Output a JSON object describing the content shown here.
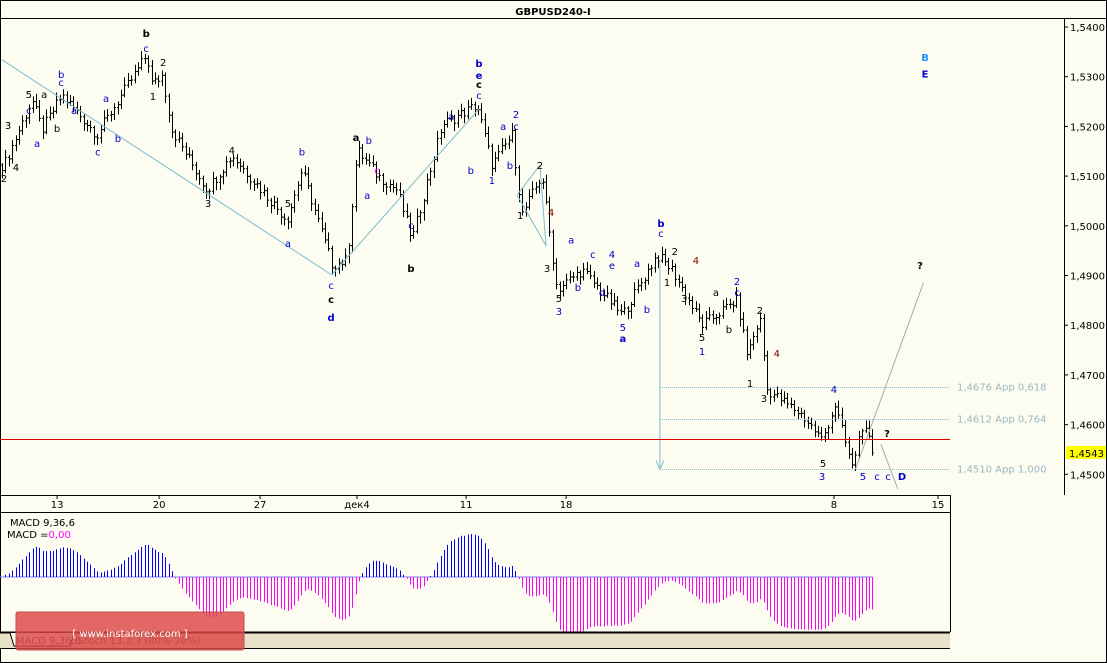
{
  "chart_data": {
    "type": "ohlc",
    "title": "GBPUSD240-I",
    "symbol": "GBPUSD",
    "timeframe": "H4",
    "ylim": [
      1.447,
      1.541
    ],
    "y_ticks": [
      "1,5400",
      "1,5300",
      "1,5200",
      "1,5100",
      "1,5000",
      "1,4900",
      "1,4800",
      "1,4700",
      "1,4600",
      "1,4500"
    ],
    "y_tick_values": [
      1.54,
      1.53,
      1.52,
      1.51,
      1.5,
      1.49,
      1.48,
      1.47,
      1.46,
      1.45
    ],
    "current_price": 1.4543,
    "current_price_label": "1,4543",
    "red_level": 1.4571,
    "x_ticks": [
      {
        "label": "13",
        "bar": 16.2
      },
      {
        "label": "20",
        "bar": 46.2
      },
      {
        "label": "27",
        "bar": 75.9
      },
      {
        "label": "дек4",
        "bar": 104.4
      },
      {
        "label": "11",
        "bar": 136.5
      },
      {
        "label": "18",
        "bar": 165.9
      },
      {
        "label": "8",
        "bar": 244.7
      },
      {
        "label": "15",
        "bar": 275.3
      }
    ],
    "price_path_pivots": [
      [
        0.6,
        1.5122
      ],
      [
        8.8,
        1.5253
      ],
      [
        11.8,
        1.5193
      ],
      [
        17.6,
        1.5263
      ],
      [
        27.9,
        1.5183
      ],
      [
        32.4,
        1.5233
      ],
      [
        42.6,
        1.5344
      ],
      [
        44.1,
        1.5283
      ],
      [
        47.1,
        1.5303
      ],
      [
        50,
        1.5193
      ],
      [
        60.3,
        1.5072
      ],
      [
        67.6,
        1.5142
      ],
      [
        83.8,
        1.5012
      ],
      [
        88.2,
        1.5112
      ],
      [
        97.1,
        1.4921
      ],
      [
        101.5,
        1.4931
      ],
      [
        104.4,
        1.5153
      ],
      [
        110.3,
        1.5102
      ],
      [
        116.2,
        1.5072
      ],
      [
        120.6,
        1.4972
      ],
      [
        129.4,
        1.5203
      ],
      [
        139.7,
        1.5243
      ],
      [
        144.1,
        1.5122
      ],
      [
        150,
        1.5183
      ],
      [
        152.9,
        1.5022
      ],
      [
        158.8,
        1.5102
      ],
      [
        163.2,
        1.4871
      ],
      [
        170.6,
        1.4911
      ],
      [
        182.4,
        1.482
      ],
      [
        192.6,
        1.4941
      ],
      [
        197.1,
        1.4911
      ],
      [
        205.9,
        1.48
      ],
      [
        216.2,
        1.4851
      ],
      [
        219.1,
        1.474
      ],
      [
        222.9,
        1.4815
      ],
      [
        225,
        1.467
      ],
      [
        235.3,
        1.4619
      ],
      [
        241.2,
        1.4569
      ],
      [
        245,
        1.4639
      ],
      [
        250,
        1.4513
      ],
      [
        252.9,
        1.4599
      ],
      [
        256.5,
        1.4543
      ]
    ],
    "fibo_levels": [
      {
        "price": 1.4676,
        "label": "1,4676 App 0,618"
      },
      {
        "price": 1.4612,
        "label": "1,4612 App 0,764"
      },
      {
        "price": 1.451,
        "label": "1,4510 App 1,000"
      }
    ],
    "fibo_start_bar": 193.5,
    "trend_lines": [
      {
        "from": [
          0,
          1.5334
        ],
        "to": [
          97,
          1.4901
        ],
        "color": "#7fbcd0"
      },
      {
        "from": [
          97,
          1.4901
        ],
        "to": [
          140.3,
          1.5235
        ],
        "color": "#7fbcd0"
      },
      {
        "from": [
          158.2,
          1.5122
        ],
        "to": [
          151.5,
          1.5062
        ],
        "color": "#7fbcd0"
      },
      {
        "from": [
          151.5,
          1.5062
        ],
        "to": [
          160,
          1.496
        ],
        "color": "#7fbcd0"
      },
      {
        "from": [
          158.2,
          1.5122
        ],
        "to": [
          160,
          1.496
        ],
        "color": "#7fbcd0"
      },
      {
        "from": [
          251,
          1.451
        ],
        "to": [
          271,
          1.4885
        ],
        "color": "#aaaaaa"
      },
      {
        "from": [
          258.5,
          1.456
        ],
        "to": [
          263.5,
          1.447
        ],
        "color": "#aaaaaa"
      }
    ],
    "fibo_arrow": {
      "bar": 193.5,
      "from": 1.4931,
      "to": 1.451
    },
    "annotations": [
      {
        "t": "3",
        "bar": 1.8,
        "p": 1.5203,
        "c": "k"
      },
      {
        "t": "4",
        "bar": 4.1,
        "p": 1.5118,
        "c": "k"
      },
      {
        "t": "2",
        "bar": 0.6,
        "p": 1.5096,
        "c": "k"
      },
      {
        "t": "5",
        "bar": 7.9,
        "p": 1.5265,
        "c": "k"
      },
      {
        "t": "a",
        "bar": 12.4,
        "p": 1.5265,
        "c": "k"
      },
      {
        "t": "c",
        "bar": 7.9,
        "p": 1.5233,
        "c": "b"
      },
      {
        "t": "a",
        "bar": 10.3,
        "p": 1.5167,
        "c": "b"
      },
      {
        "t": "b",
        "bar": 17.4,
        "p": 1.5305,
        "c": "b"
      },
      {
        "t": "c",
        "bar": 17.4,
        "p": 1.5289,
        "c": "b"
      },
      {
        "t": "b",
        "bar": 16.2,
        "p": 1.5197,
        "c": "k"
      },
      {
        "t": "a",
        "bar": 21.2,
        "p": 1.5233,
        "c": "b"
      },
      {
        "t": "a",
        "bar": 30.6,
        "p": 1.5257,
        "c": "b"
      },
      {
        "t": "c",
        "bar": 28.2,
        "p": 1.5149,
        "c": "b"
      },
      {
        "t": "b",
        "bar": 34.1,
        "p": 1.5177,
        "c": "b"
      },
      {
        "t": "b",
        "bar": 42.4,
        "p": 1.5388,
        "c": "k",
        "bold": true
      },
      {
        "t": "c",
        "bar": 42.4,
        "p": 1.5358,
        "c": "b"
      },
      {
        "t": "2",
        "bar": 47.4,
        "p": 1.533,
        "c": "k"
      },
      {
        "t": "1",
        "bar": 44.4,
        "p": 1.5261,
        "c": "k"
      },
      {
        "t": "4",
        "bar": 67.6,
        "p": 1.5153,
        "c": "k"
      },
      {
        "t": "3",
        "bar": 60.6,
        "p": 1.5046,
        "c": "k"
      },
      {
        "t": "5",
        "bar": 84.1,
        "p": 1.5046,
        "c": "k"
      },
      {
        "t": "a",
        "bar": 84.1,
        "p": 1.4965,
        "c": "b"
      },
      {
        "t": "b",
        "bar": 88.2,
        "p": 1.5149,
        "c": "b"
      },
      {
        "t": "c",
        "bar": 96.8,
        "p": 1.4881,
        "c": "b"
      },
      {
        "t": "c",
        "bar": 96.8,
        "p": 1.4853,
        "c": "k",
        "bold": true
      },
      {
        "t": "d",
        "bar": 96.8,
        "p": 1.4816,
        "c": "b",
        "bold": true
      },
      {
        "t": "a",
        "bar": 104.1,
        "p": 1.5179,
        "c": "k",
        "bold": true
      },
      {
        "t": "b",
        "bar": 107.9,
        "p": 1.5173,
        "c": "b"
      },
      {
        "t": "a",
        "bar": 107.4,
        "p": 1.5062,
        "c": "b"
      },
      {
        "t": "c",
        "bar": 110.3,
        "p": 1.5112,
        "c": "m"
      },
      {
        "t": "c",
        "bar": 120.3,
        "p": 1.5002,
        "c": "b"
      },
      {
        "t": "b",
        "bar": 120.3,
        "p": 1.4915,
        "c": "k",
        "bold": true
      },
      {
        "t": "a",
        "bar": 132.1,
        "p": 1.5221,
        "c": "b"
      },
      {
        "t": "b",
        "bar": 137.9,
        "p": 1.5112,
        "c": "b"
      },
      {
        "t": "b",
        "bar": 140.3,
        "p": 1.5328,
        "c": "b",
        "bold": true
      },
      {
        "t": "e",
        "bar": 140.3,
        "p": 1.5303,
        "c": "b",
        "bold": true
      },
      {
        "t": "c",
        "bar": 140.3,
        "p": 1.5285,
        "c": "k",
        "bold": true
      },
      {
        "t": "c",
        "bar": 140.3,
        "p": 1.5263,
        "c": "b"
      },
      {
        "t": "a",
        "bar": 147.4,
        "p": 1.5201,
        "c": "b"
      },
      {
        "t": "2",
        "bar": 151.2,
        "p": 1.5225,
        "c": "b"
      },
      {
        "t": "c",
        "bar": 151.2,
        "p": 1.5201,
        "c": "b"
      },
      {
        "t": "b",
        "bar": 149.4,
        "p": 1.5122,
        "c": "b"
      },
      {
        "t": "1",
        "bar": 144.1,
        "p": 1.5092,
        "c": "b"
      },
      {
        "t": "2",
        "bar": 158.2,
        "p": 1.5122,
        "c": "k"
      },
      {
        "t": "1",
        "bar": 152.4,
        "p": 1.5022,
        "c": "k"
      },
      {
        "t": "4",
        "bar": 161.5,
        "p": 1.5028,
        "c": "br"
      },
      {
        "t": "3",
        "bar": 160.3,
        "p": 1.4915,
        "c": "k"
      },
      {
        "t": "5",
        "bar": 163.8,
        "p": 1.4855,
        "c": "k"
      },
      {
        "t": "3",
        "bar": 163.8,
        "p": 1.4829,
        "c": "b"
      },
      {
        "t": "a",
        "bar": 167.4,
        "p": 1.4972,
        "c": "b"
      },
      {
        "t": "b",
        "bar": 169.4,
        "p": 1.4877,
        "c": "b"
      },
      {
        "t": "c",
        "bar": 173.8,
        "p": 1.4943,
        "c": "b"
      },
      {
        "t": "d",
        "bar": 176.5,
        "p": 1.4867,
        "c": "b"
      },
      {
        "t": "4",
        "bar": 179.4,
        "p": 1.4943,
        "c": "b"
      },
      {
        "t": "e",
        "bar": 179.4,
        "p": 1.4921,
        "c": "b"
      },
      {
        "t": "5",
        "bar": 182.6,
        "p": 1.4796,
        "c": "b"
      },
      {
        "t": "a",
        "bar": 182.6,
        "p": 1.4774,
        "c": "b",
        "bold": true
      },
      {
        "t": "a",
        "bar": 186.8,
        "p": 1.4925,
        "c": "b"
      },
      {
        "t": "b",
        "bar": 189.7,
        "p": 1.4833,
        "c": "b"
      },
      {
        "t": "b",
        "bar": 193.8,
        "p": 1.5006,
        "c": "b",
        "bold": true
      },
      {
        "t": "c",
        "bar": 193.8,
        "p": 1.4986,
        "c": "b"
      },
      {
        "t": "1",
        "bar": 195.6,
        "p": 1.4887,
        "c": "k"
      },
      {
        "t": "2",
        "bar": 197.9,
        "p": 1.4949,
        "c": "k"
      },
      {
        "t": "3",
        "bar": 200.6,
        "p": 1.4855,
        "c": "k"
      },
      {
        "t": "4",
        "bar": 204.1,
        "p": 1.4931,
        "c": "br"
      },
      {
        "t": "5",
        "bar": 205.9,
        "p": 1.4776,
        "c": "k"
      },
      {
        "t": "1",
        "bar": 205.9,
        "p": 1.4748,
        "c": "b"
      },
      {
        "t": "a",
        "bar": 210,
        "p": 1.4867,
        "c": "k"
      },
      {
        "t": "b",
        "bar": 213.8,
        "p": 1.4792,
        "c": "k"
      },
      {
        "t": "2",
        "bar": 216.2,
        "p": 1.4889,
        "c": "b"
      },
      {
        "t": "c",
        "bar": 216.2,
        "p": 1.4867,
        "c": "b"
      },
      {
        "t": "2",
        "bar": 222.9,
        "p": 1.4831,
        "c": "k"
      },
      {
        "t": "4",
        "bar": 227.9,
        "p": 1.4744,
        "c": "br"
      },
      {
        "t": "1",
        "bar": 220,
        "p": 1.4684,
        "c": "k"
      },
      {
        "t": "3",
        "bar": 224.1,
        "p": 1.4654,
        "c": "k"
      },
      {
        "t": "4",
        "bar": 244.7,
        "p": 1.4672,
        "c": "b"
      },
      {
        "t": "5",
        "bar": 241.5,
        "p": 1.4523,
        "c": "k"
      },
      {
        "t": "3",
        "bar": 241.2,
        "p": 1.4497,
        "c": "b"
      },
      {
        "t": "5",
        "bar": 253.2,
        "p": 1.4497,
        "c": "b"
      },
      {
        "t": "c",
        "bar": 257.4,
        "p": 1.4497,
        "c": "b"
      },
      {
        "t": "c",
        "bar": 260.6,
        "p": 1.4497,
        "c": "b"
      },
      {
        "t": "D",
        "bar": 264.7,
        "p": 1.4497,
        "c": "b",
        "bold": true
      },
      {
        "t": "?",
        "bar": 260.3,
        "p": 1.4583,
        "c": "k",
        "bold": true
      },
      {
        "t": "?",
        "bar": 270,
        "p": 1.4921,
        "c": "k",
        "bold": true
      },
      {
        "t": "B",
        "bar": 271.5,
        "p": 1.534,
        "c": "lb",
        "bold": true
      },
      {
        "t": "E",
        "bar": 271.5,
        "p": 1.5306,
        "c": "b",
        "bold": true
      }
    ],
    "indicator": {
      "name": "MACD 9,36,6",
      "value_prefix": "MACD =",
      "value": "0,00",
      "fast": 9,
      "slow": 36,
      "signal": 6,
      "positive_color": "#0000ff",
      "negative_color": "#ff00ff"
    }
  },
  "colors": {
    "k": "#000000",
    "b": "#0000cc",
    "lb": "#1e90ff",
    "br": "#800000",
    "m": "#ff00ff"
  },
  "tabs": [
    "MACD 9,36,6",
    "Stoch 13,3,3 (80%-20%)"
  ],
  "watermark": "[ www.instaforex.com ]"
}
